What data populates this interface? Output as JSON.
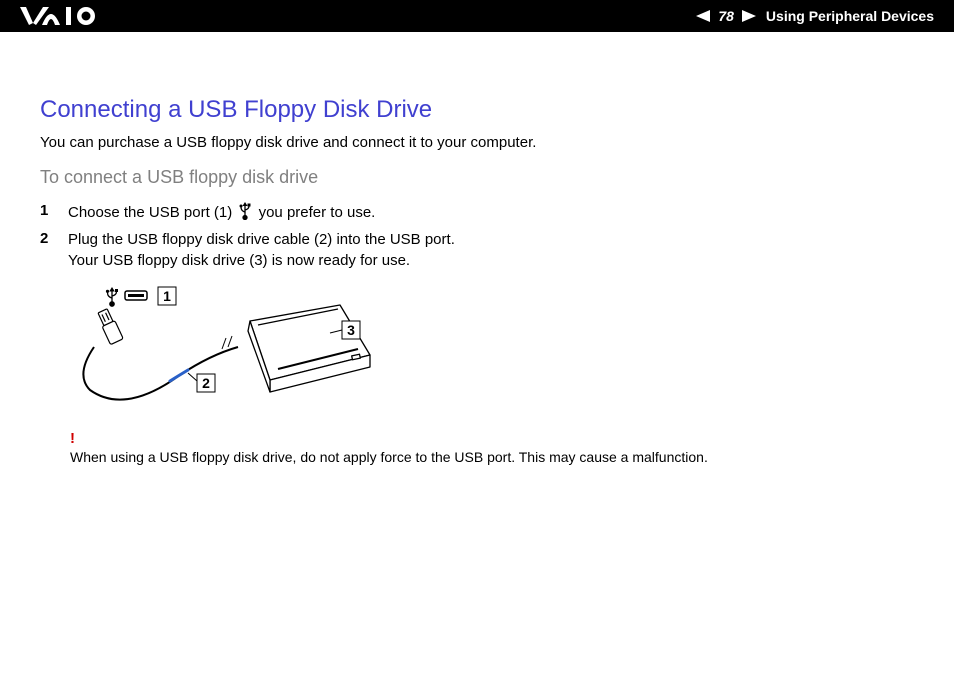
{
  "header": {
    "page_number": "78",
    "section": "Using Peripheral Devices"
  },
  "page": {
    "title": "Connecting a USB Floppy Disk Drive",
    "intro": "You can purchase a USB floppy disk drive and connect it to your computer.",
    "subheading": "To connect a USB floppy disk drive"
  },
  "steps": [
    {
      "num": "1",
      "text_before": "Choose the USB port (1) ",
      "text_after": " you prefer to use."
    },
    {
      "num": "2",
      "line1": "Plug the USB floppy disk drive cable (2) into the USB port.",
      "line2": "Your USB floppy disk drive (3) is now ready for use."
    }
  ],
  "diagram": {
    "callouts": {
      "c1": "1",
      "c2": "2",
      "c3": "3"
    }
  },
  "warning": {
    "icon": "!",
    "text": "When using a USB floppy disk drive, do not apply force to the USB port. This may cause a malfunction."
  }
}
